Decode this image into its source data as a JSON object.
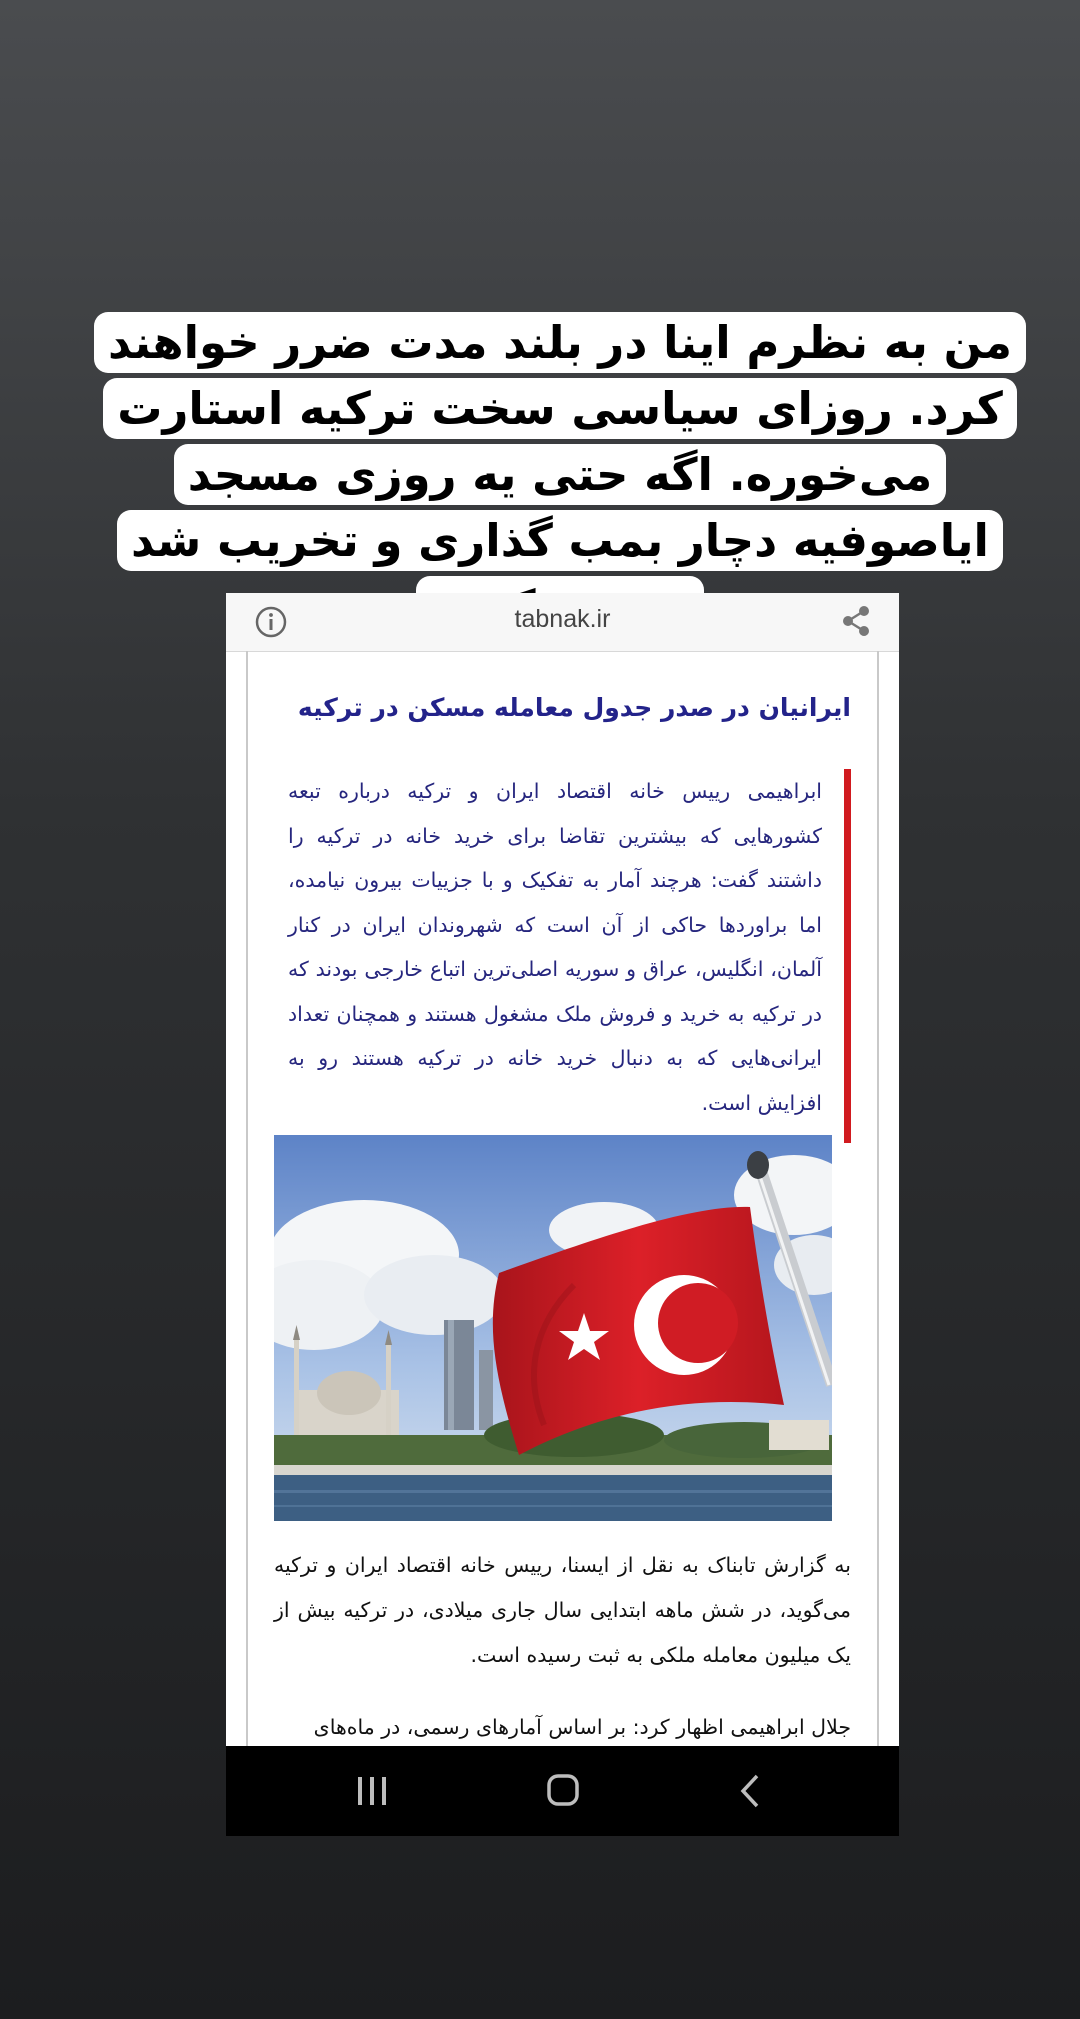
{
  "caption": {
    "text": "من به نظرم اینا در بلند مدت ضرر خواهند کرد. روزای سیاسی سخت ترکیه استارت می‌خوره. اگه حتی یه روزی مسجد ایاصوفیه دچار بمب گذاری و تخریب شد تعجب نکنید."
  },
  "browser": {
    "domain": "tabnak.ir",
    "info_icon": "info-icon",
    "share_icon": "share-icon"
  },
  "article": {
    "headline": "ایرانیان در صدر جدول معامله مسکن در ترکیه",
    "lead": "ابراهیمی رییس خانه اقتصاد ایران و ترکیه درباره تبعه کشورهایی که بیشترین تقاضا برای خرید خانه در ترکیه را داشتند گفت: هرچند آمار به تفکیک و با جزییات بیرون نیامده، اما براوردها حاکی از آن است که شهروندان ایران در کنار آلمان، انگلیس، عراق و سوریه اصلی‌ترین اتباع خارجی بودند که در ترکیه به خرید و فروش ملک مشغول هستند و همچنان تعداد ایرانی‌هایی که به دنبال خرید خانه در ترکیه هستند رو به افزایش است.",
    "photo": "turkish-flag-istanbul-photo",
    "paragraph1": "به گزارش تابناک به نقل از ایسنا، رییس خانه اقتصاد ایران و ترکیه می‌گوید، در شش ماهه ابتدایی سال جاری میلادی، در ترکیه بیش از یک میلیون معامله ملکی به ثبت رسیده است.",
    "paragraph2": "جلال ابراهیمی اظهار کرد: بر اساس آمارهای رسمی، در ماه‌های"
  },
  "navbar": {
    "recents": "recents-icon",
    "home": "home-icon",
    "back": "back-icon"
  },
  "colors": {
    "headline": "#23238a",
    "lead_text": "#26267e",
    "lead_border": "#d11a1f",
    "flag_red": "#d01c24"
  }
}
